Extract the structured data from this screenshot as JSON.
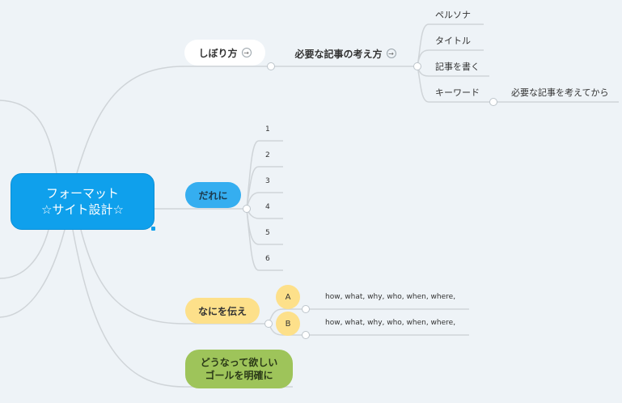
{
  "root": {
    "line1": "フォーマット",
    "line2": "☆サイト設計☆"
  },
  "branches": {
    "shibori": {
      "label": "しぼり方",
      "arrow": "→"
    },
    "hitsuyou": {
      "label": "必要な記事の考え方",
      "arrow": "→"
    },
    "hitsuyou_children": [
      "ペルソナ",
      "タイトル",
      "記事を書く",
      "キーワード"
    ],
    "keyword_child": "必要な記事を考えてから",
    "dareni": {
      "label": "だれに"
    },
    "dareni_children": [
      "1",
      "2",
      "3",
      "4",
      "5",
      "6"
    ],
    "nani": {
      "label": "なにを伝え"
    },
    "nani_children": [
      {
        "badge": "A",
        "text": "how, what, why, who, when, where,"
      },
      {
        "badge": "B",
        "text": "how, what, why, who, when, where,"
      }
    ],
    "goal": {
      "line1": "どうなって欲しい",
      "line2": "ゴールを明確に"
    }
  },
  "colors": {
    "background": "#eef3f7",
    "root": "#0fa0ec",
    "dareni": "#35aef0",
    "nani": "#fde08a",
    "goal": "#9ec45a",
    "connector": "#c8ced3"
  }
}
